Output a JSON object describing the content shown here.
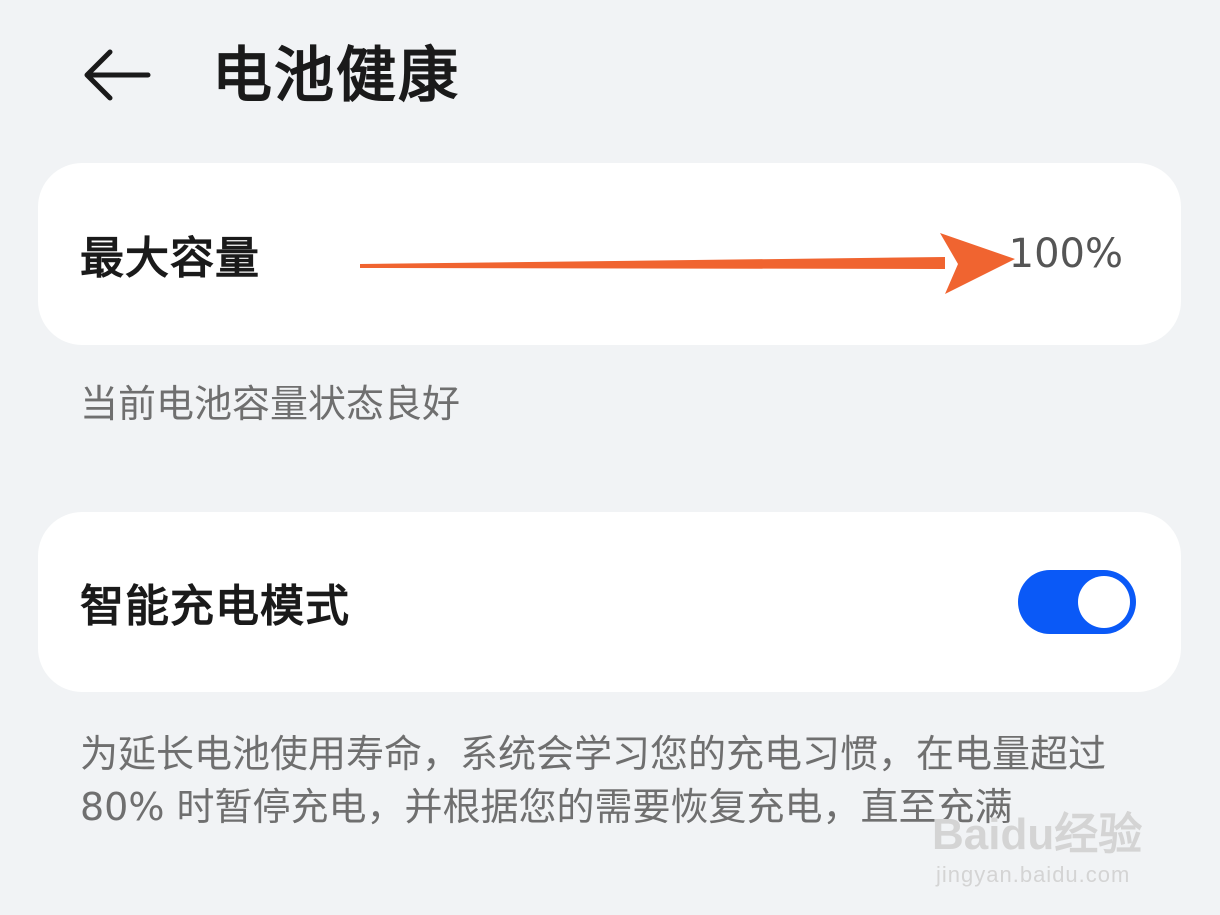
{
  "header": {
    "back_icon": "arrow-left-icon",
    "title": "电池健康"
  },
  "capacity": {
    "label": "最大容量",
    "value": "100%",
    "description": "当前电池容量状态良好"
  },
  "annotation": {
    "arrow_color": "#f06430"
  },
  "smart_charge": {
    "label": "智能充电模式",
    "toggle_on": true,
    "toggle_color": "#0a59f7",
    "description": "为延长电池使用寿命，系统会学习您的充电习惯，在电量超过 80% 时暂停充电，并根据您的需要恢复充电，直至充满"
  },
  "watermark": {
    "logo": "Baidu经验",
    "url": "jingyan.baidu.com"
  },
  "colors": {
    "background": "#f1f3f5",
    "card": "#ffffff"
  }
}
